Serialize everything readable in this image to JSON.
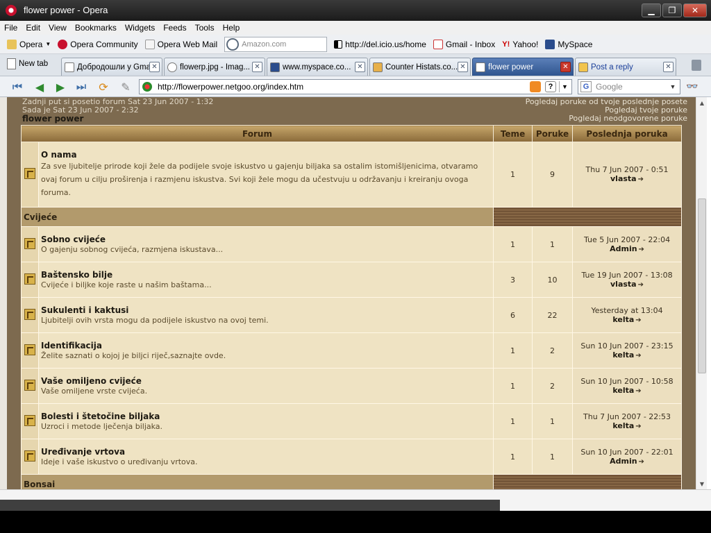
{
  "window": {
    "title": "flower power - Opera"
  },
  "menu": [
    "File",
    "Edit",
    "View",
    "Bookmarks",
    "Widgets",
    "Feeds",
    "Tools",
    "Help"
  ],
  "bookmarks": {
    "opera": "Opera",
    "community": "Opera Community",
    "webmail": "Opera Web Mail",
    "search_placeholder": "Amazon.com",
    "delicious": "http://del.icio.us/home",
    "gmail": "Gmail - Inbox",
    "yahoo": "Yahoo!",
    "myspace": "MySpace"
  },
  "tabs": {
    "new_tab": "New tab",
    "items": [
      {
        "label": "Добродошли у Gmail",
        "active": false
      },
      {
        "label": "flowerp.jpg - Imag...",
        "active": false
      },
      {
        "label": "www.myspace.co...",
        "active": false
      },
      {
        "label": "Counter Histats.co...",
        "active": false
      },
      {
        "label": "flower power",
        "active": true
      },
      {
        "label": "Post a reply",
        "active": false
      }
    ]
  },
  "nav": {
    "url": "http://flowerpower.netgoo.org/index.htm",
    "search_placeholder": "Google"
  },
  "info": {
    "last_visit": "Zadnji put si posetio forum Sat 23 Jun 2007 - 1:32",
    "now": "Sada je Sat 23 Jun 2007 - 2:32",
    "site_name": "flower power",
    "link1": "Pogledaj poruke od tvoje poslednje posete",
    "link2": "Pogledaj tvoje poruke",
    "link3": "Pogledaj neodgovorene poruke"
  },
  "table": {
    "headers": {
      "forum": "Forum",
      "topics": "Teme",
      "posts": "Poruke",
      "last": "Poslednja poruka"
    },
    "about": {
      "title": "O nama",
      "desc": "Za sve ljubitelje prirode koji žele da podijele svoje iskustvo u gajenju biljaka sa ostalim istomišljenicima, otvaramo ovaj forum u cilju proširenja i razmjenu iskustva. Svi koji žele mogu da učestvuju u održavanju i kreiranju ovoga foruma.",
      "topics": "1",
      "posts": "9",
      "last_date": "Thu 7 Jun 2007 - 0:51",
      "last_user": "vlasta"
    },
    "category1": "Cvijeće",
    "forums": [
      {
        "title": "Sobno cvijeće",
        "desc": "O gajenju sobnog cvijeća, razmjena iskustava...",
        "topics": "1",
        "posts": "1",
        "last_date": "Tue 5 Jun 2007 - 22:04",
        "last_user": "Admin"
      },
      {
        "title": "Baštensko bilje",
        "desc": "Cvijeće i biljke koje raste u našim baštama...",
        "topics": "3",
        "posts": "10",
        "last_date": "Tue 19 Jun 2007 - 13:08",
        "last_user": "vlasta"
      },
      {
        "title": "Sukulenti i kaktusi",
        "desc": "Ljubitelji ovih vrsta mogu da podijele iskustvo na ovoj temi.",
        "topics": "6",
        "posts": "22",
        "last_date": "Yesterday at 13:04",
        "last_user": "kelta"
      },
      {
        "title": "Identifikacija",
        "desc": "Želite saznati o kojoj je biljci riječ,saznajte ovde.",
        "topics": "1",
        "posts": "2",
        "last_date": "Sun 10 Jun 2007 - 23:15",
        "last_user": "kelta"
      },
      {
        "title": "Vaše omiljeno cvijeće",
        "desc": "Vaše omiljene vrste cvijeća.",
        "topics": "1",
        "posts": "2",
        "last_date": "Sun 10 Jun 2007 - 10:58",
        "last_user": "kelta"
      },
      {
        "title": "Bolesti i štetočine biljaka",
        "desc": "Uzroci i metode lječenja biljaka.",
        "topics": "1",
        "posts": "1",
        "last_date": "Thu 7 Jun 2007 - 22:53",
        "last_user": "kelta"
      },
      {
        "title": "Uređivanje vrtova",
        "desc": "Ideje i vaše iskustvo o uređivanju vrtova.",
        "topics": "1",
        "posts": "1",
        "last_date": "Sun 10 Jun 2007 - 22:01",
        "last_user": "Admin"
      }
    ],
    "category2": "Bonsai"
  }
}
